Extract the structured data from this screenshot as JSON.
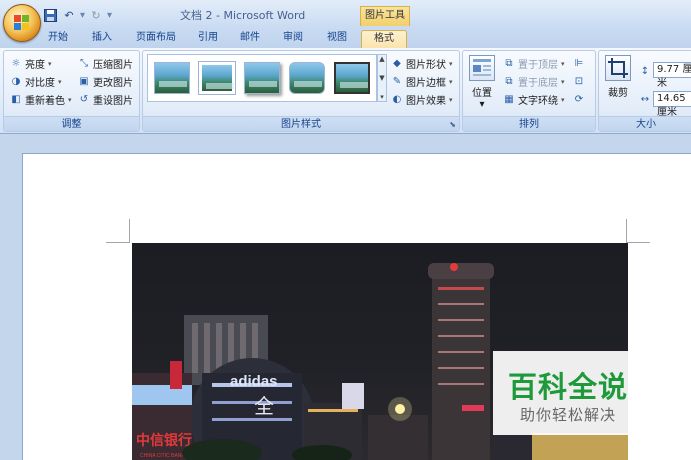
{
  "window": {
    "title": "文档 2 - Microsoft Word",
    "context_tool": "图片工具"
  },
  "tabs": [
    {
      "label": "开始"
    },
    {
      "label": "插入"
    },
    {
      "label": "页面布局"
    },
    {
      "label": "引用"
    },
    {
      "label": "邮件"
    },
    {
      "label": "审阅"
    },
    {
      "label": "视图"
    },
    {
      "label": "格式",
      "active": true
    }
  ],
  "groups": {
    "adjust": {
      "label": "调整",
      "buttons": {
        "brightness": "亮度",
        "contrast": "对比度",
        "recolor": "重新着色",
        "compress": "压缩图片",
        "change": "更改图片",
        "reset": "重设图片"
      }
    },
    "styles": {
      "label": "图片样式",
      "shape": "图片形状",
      "border": "图片边框",
      "effects": "图片效果"
    },
    "arrange": {
      "label": "排列",
      "position": "位置",
      "bring_front": "置于顶层",
      "send_back": "置于底层",
      "wrap": "文字环绕"
    },
    "size": {
      "label": "大小",
      "crop": "裁剪",
      "height": "9.77 厘米",
      "width": "14.65 厘米"
    }
  },
  "photo": {
    "signs": {
      "adidas": "adidas",
      "bank": "中信银行",
      "bank_en": "CHINA CITIC BANK",
      "quan": "全"
    }
  },
  "watermark": {
    "title": "百科全说",
    "subtitle": "助你轻松解决"
  },
  "colors": {
    "ribbon_accent": "#15428b",
    "watermark_green": "#1f9a3b",
    "context_tab": "#f3cf6a"
  }
}
